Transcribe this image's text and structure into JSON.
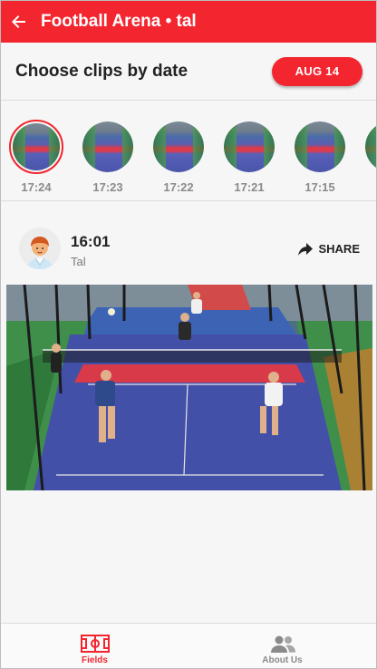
{
  "header": {
    "title": "Football Arena • tal",
    "background": "#f3252f"
  },
  "date_row": {
    "title": "Choose clips by date",
    "date_button": "AUG 14"
  },
  "clips": [
    {
      "time": "17:24",
      "selected": true
    },
    {
      "time": "17:23",
      "selected": false
    },
    {
      "time": "17:22",
      "selected": false
    },
    {
      "time": "17:21",
      "selected": false
    },
    {
      "time": "17:15",
      "selected": false
    }
  ],
  "post": {
    "time": "16:01",
    "user": "Tal",
    "share_label": "SHARE",
    "avatar_icon": "boy-avatar-icon",
    "share_icon": "share-arrow-icon"
  },
  "bottom_nav": {
    "items": [
      {
        "label": "Fields",
        "icon": "field-icon",
        "active": true
      },
      {
        "label": "About Us",
        "icon": "people-icon",
        "active": false
      }
    ]
  },
  "colors": {
    "accent": "#f3252f",
    "muted_text": "#8a8a8a"
  }
}
